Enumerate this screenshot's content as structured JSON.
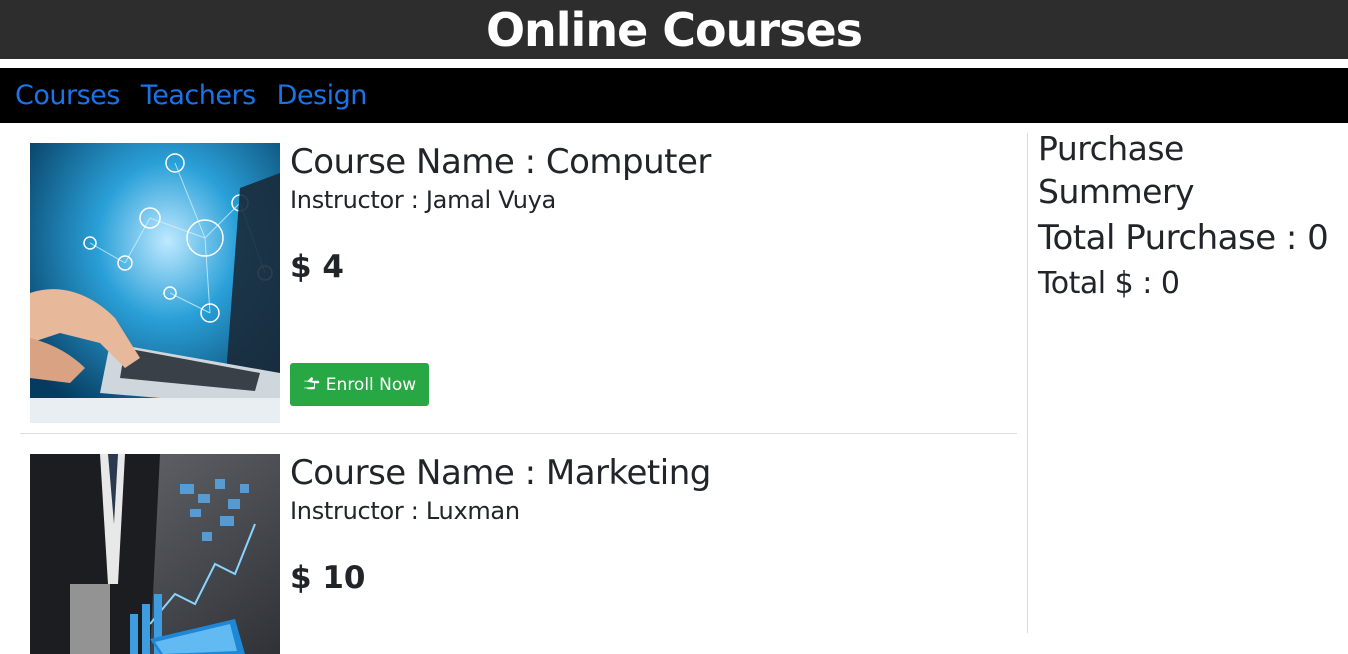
{
  "header": {
    "title": "Online Courses"
  },
  "nav": {
    "items": [
      {
        "label": "Courses"
      },
      {
        "label": "Teachers"
      },
      {
        "label": "Design"
      }
    ]
  },
  "courses": [
    {
      "name": "Course Name : Computer",
      "instructor": "Instructor : Jamal Vuya",
      "price": "$ 4",
      "button_label": "Enroll Now",
      "button_icon": "hand-pointing-right-icon"
    },
    {
      "name": "Course Name : Marketing",
      "instructor": "Instructor : Luxman",
      "price": "$ 10"
    }
  ],
  "summary": {
    "heading": "Purchase Summery",
    "total_purchase": "Total Purchase : 0",
    "total_dollar": "Total $ : 0"
  },
  "colors": {
    "title_bg": "#2d2d2d",
    "nav_bg": "#000000",
    "nav_link": "#1a73e8",
    "enroll_button": "#28a745"
  }
}
